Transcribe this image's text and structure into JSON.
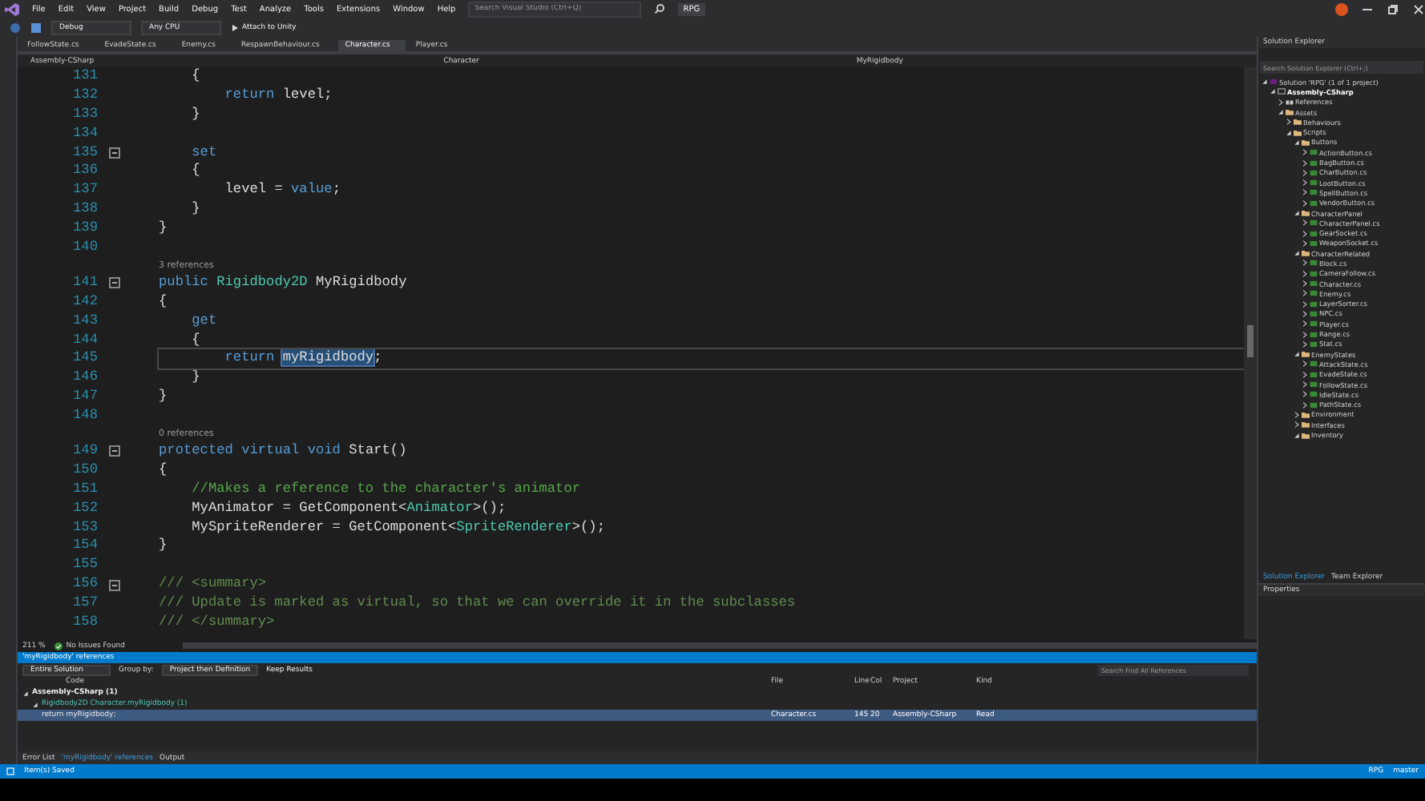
{
  "menu": [
    "File",
    "Edit",
    "View",
    "Project",
    "Build",
    "Debug",
    "Test",
    "Analyze",
    "Tools",
    "Extensions",
    "Window",
    "Help"
  ],
  "search": {
    "placeholder": "Search Visual Studio (Ctrl+Q)"
  },
  "project_name": "RPG",
  "toolbar": {
    "configuration": "Debug",
    "platform": "Any CPU",
    "run": "Attach to Unity"
  },
  "tabs": [
    {
      "label": "FollowState.cs",
      "selected": false
    },
    {
      "label": "EvadeState.cs",
      "selected": false
    },
    {
      "label": "Enemy.cs",
      "selected": false
    },
    {
      "label": "RespawnBehaviour.cs",
      "selected": false
    },
    {
      "label": "Character.cs",
      "selected": true
    },
    {
      "label": "Player.cs",
      "selected": false
    }
  ],
  "nav": [
    "Assembly-CSharp",
    "Character",
    "MyRigidbody"
  ],
  "code": [
    {
      "kind": "code",
      "number": "131",
      "tokens": [
        {
          "kind": "plain",
          "text": "    {"
        }
      ]
    },
    {
      "kind": "code",
      "number": "132",
      "tokens": [
        {
          "kind": "keyword",
          "text": "        return"
        },
        {
          "kind": "plain",
          "text": " level;"
        }
      ]
    },
    {
      "kind": "code",
      "number": "133",
      "tokens": [
        {
          "kind": "plain",
          "text": "    }"
        }
      ]
    },
    {
      "kind": "code",
      "number": "134"
    },
    {
      "kind": "code",
      "number": "135",
      "fold": true,
      "tokens": [
        {
          "kind": "keyword",
          "text": "    set"
        }
      ]
    },
    {
      "kind": "code",
      "number": "136",
      "tokens": [
        {
          "kind": "plain",
          "text": "    {"
        }
      ]
    },
    {
      "kind": "code",
      "number": "137",
      "tokens": [
        {
          "kind": "plain",
          "text": "        level = "
        },
        {
          "kind": "keyword",
          "text": "value"
        },
        {
          "kind": "plain",
          "text": ";"
        }
      ]
    },
    {
      "kind": "code",
      "number": "138",
      "tokens": [
        {
          "kind": "plain",
          "text": "    }"
        }
      ]
    },
    {
      "kind": "code",
      "number": "139",
      "tokens": [
        {
          "kind": "plain",
          "text": "}"
        }
      ]
    },
    {
      "kind": "code",
      "number": "140"
    },
    {
      "kind": "lens",
      "text": "3 references"
    },
    {
      "kind": "code",
      "number": "141",
      "fold": true,
      "tokens": [
        {
          "kind": "keyword",
          "text": "public "
        },
        {
          "kind": "type",
          "text": "Rigidbody2D"
        },
        {
          "kind": "plain",
          "text": " MyRigidbody"
        }
      ]
    },
    {
      "kind": "code",
      "number": "142",
      "tokens": [
        {
          "kind": "plain",
          "text": "{"
        }
      ]
    },
    {
      "kind": "code",
      "number": "143",
      "tokens": [
        {
          "kind": "keyword",
          "text": "    get"
        }
      ]
    },
    {
      "kind": "code",
      "number": "144",
      "tokens": [
        {
          "kind": "plain",
          "text": "    {"
        }
      ]
    },
    {
      "kind": "code",
      "number": "145",
      "current": true,
      "tokens": [
        {
          "kind": "keyword",
          "text": "        return "
        },
        {
          "kind": "highlight",
          "text": "myRigidbody"
        },
        {
          "kind": "plain",
          "text": ";"
        }
      ]
    },
    {
      "kind": "code",
      "number": "146",
      "tokens": [
        {
          "kind": "plain",
          "text": "    }"
        }
      ]
    },
    {
      "kind": "code",
      "number": "147",
      "tokens": [
        {
          "kind": "plain",
          "text": "}"
        }
      ]
    },
    {
      "kind": "code",
      "number": "148"
    },
    {
      "kind": "lens",
      "text": "0 references"
    },
    {
      "kind": "code",
      "number": "149",
      "fold": true,
      "tokens": [
        {
          "kind": "keyword",
          "text": "protected virtual void"
        },
        {
          "kind": "plain",
          "text": " Start()"
        }
      ]
    },
    {
      "kind": "code",
      "number": "150",
      "tokens": [
        {
          "kind": "plain",
          "text": "{"
        }
      ]
    },
    {
      "kind": "code",
      "number": "151",
      "tokens": [
        {
          "kind": "comment",
          "text": "    //Makes a reference to the character's animator"
        }
      ]
    },
    {
      "kind": "code",
      "number": "152",
      "tokens": [
        {
          "kind": "plain",
          "text": "    MyAnimator = GetComponent<"
        },
        {
          "kind": "type",
          "text": "Animator"
        },
        {
          "kind": "plain",
          "text": ">();"
        }
      ]
    },
    {
      "kind": "code",
      "number": "153",
      "tokens": [
        {
          "kind": "plain",
          "text": "    MySpriteRenderer = GetComponent<"
        },
        {
          "kind": "type",
          "text": "SpriteRenderer"
        },
        {
          "kind": "plain",
          "text": ">();"
        }
      ]
    },
    {
      "kind": "code",
      "number": "154",
      "tokens": [
        {
          "kind": "plain",
          "text": "}"
        }
      ]
    },
    {
      "kind": "code",
      "number": "155"
    },
    {
      "kind": "code",
      "number": "156",
      "fold": true,
      "tokens": [
        {
          "kind": "doc",
          "text": "/// <summary>"
        }
      ]
    },
    {
      "kind": "code",
      "number": "157",
      "tokens": [
        {
          "kind": "doc",
          "text": "/// Update is marked as virtual, so that we can override it in the subclasses"
        }
      ]
    },
    {
      "kind": "code",
      "number": "158",
      "tokens": [
        {
          "kind": "doc",
          "text": "/// </summary>"
        }
      ]
    }
  ],
  "editor_footer": {
    "zoom": "211 %",
    "issues": "No Issues Found"
  },
  "references_panel": {
    "title": "'myRigidbody' references",
    "scope": "Entire Solution",
    "group_by_label": "Group by:",
    "group_by": "Project then Definition",
    "keep_results": "Keep Results",
    "search_placeholder": "Search Find All References",
    "columns": [
      "Code",
      "File",
      "Line",
      "Col",
      "Project",
      "Kind"
    ],
    "rows": [
      {
        "kind": "project",
        "code": "Assembly-CSharp (1)",
        "expanded": true,
        "children": [
          {
            "kind": "definition",
            "code": "Rigidbody2D Character.myRigidbody (1)",
            "expanded": true,
            "children": [
              {
                "kind": "reference",
                "code": "return myRigidbody;",
                "file": "Character.cs",
                "line": "145",
                "col": "20",
                "project": "Assembly-CSharp",
                "ref_kind": "Read",
                "selected": true
              }
            ]
          }
        ]
      }
    ]
  },
  "bottom_tabs": [
    {
      "label": "Error List",
      "selected": false
    },
    {
      "label": "'myRigidbody' references",
      "selected": true
    },
    {
      "label": "Output",
      "selected": false
    }
  ],
  "solution_explorer": {
    "title": "Solution Explorer",
    "search_placeholder": "Search Solution Explorer (Ctrl+;)",
    "tree": [
      {
        "label": "Solution 'RPG' (1 of 1 project)",
        "kind": "solution",
        "expanded": true,
        "children": [
          {
            "label": "Assembly-CSharp",
            "kind": "project",
            "expanded": true,
            "children": [
              {
                "label": "References",
                "kind": "references",
                "expanded": false
              },
              {
                "label": "Assets",
                "kind": "folder",
                "expanded": true,
                "children": [
                  {
                    "label": "Behaviours",
                    "kind": "folder",
                    "expanded": false
                  },
                  {
                    "label": "Scripts",
                    "kind": "folder",
                    "expanded": true,
                    "children": [
                      {
                        "label": "Buttons",
                        "kind": "folder",
                        "expanded": true,
                        "children": [
                          {
                            "label": "ActionButton.cs",
                            "kind": "cs",
                            "expanded": false
                          },
                          {
                            "label": "BagButton.cs",
                            "kind": "cs",
                            "expanded": false
                          },
                          {
                            "label": "CharButton.cs",
                            "kind": "cs",
                            "expanded": false
                          },
                          {
                            "label": "LootButton.cs",
                            "kind": "cs",
                            "expanded": false
                          },
                          {
                            "label": "SpellButton.cs",
                            "kind": "cs",
                            "expanded": false
                          },
                          {
                            "label": "VendorButton.cs",
                            "kind": "cs",
                            "expanded": false
                          }
                        ]
                      },
                      {
                        "label": "CharacterPanel",
                        "kind": "folder",
                        "expanded": true,
                        "children": [
                          {
                            "label": "CharacterPanel.cs",
                            "kind": "cs",
                            "expanded": false
                          },
                          {
                            "label": "GearSocket.cs",
                            "kind": "cs",
                            "expanded": false
                          },
                          {
                            "label": "WeaponSocket.cs",
                            "kind": "cs",
                            "expanded": false
                          }
                        ]
                      },
                      {
                        "label": "CharacterRelated",
                        "kind": "folder",
                        "expanded": true,
                        "children": [
                          {
                            "label": "Block.cs",
                            "kind": "cs",
                            "expanded": false
                          },
                          {
                            "label": "CameraFollow.cs",
                            "kind": "cs",
                            "expanded": false
                          },
                          {
                            "label": "Character.cs",
                            "kind": "cs",
                            "expanded": false
                          },
                          {
                            "label": "Enemy.cs",
                            "kind": "cs",
                            "expanded": false
                          },
                          {
                            "label": "LayerSorter.cs",
                            "kind": "cs",
                            "expanded": false
                          },
                          {
                            "label": "NPC.cs",
                            "kind": "cs",
                            "expanded": false
                          },
                          {
                            "label": "Player.cs",
                            "kind": "cs",
                            "expanded": false
                          },
                          {
                            "label": "Range.cs",
                            "kind": "cs",
                            "expanded": false
                          },
                          {
                            "label": "Stat.cs",
                            "kind": "cs",
                            "expanded": false
                          }
                        ]
                      },
                      {
                        "label": "EnemyStates",
                        "kind": "folder",
                        "expanded": true,
                        "children": [
                          {
                            "label": "AttackState.cs",
                            "kind": "cs",
                            "expanded": false
                          },
                          {
                            "label": "EvadeState.cs",
                            "kind": "cs",
                            "expanded": false
                          },
                          {
                            "label": "FollowState.cs",
                            "kind": "cs",
                            "expanded": false
                          },
                          {
                            "label": "IdleState.cs",
                            "kind": "cs",
                            "expanded": false
                          },
                          {
                            "label": "PathState.cs",
                            "kind": "cs",
                            "expanded": false
                          }
                        ]
                      },
                      {
                        "label": "Environment",
                        "kind": "folder",
                        "expanded": false
                      },
                      {
                        "label": "Interfaces",
                        "kind": "folder",
                        "expanded": false
                      },
                      {
                        "label": "Inventory",
                        "kind": "folder",
                        "expanded": true
                      }
                    ]
                  }
                ]
              }
            ]
          }
        ]
      }
    ],
    "tabs": [
      {
        "label": "Solution Explorer",
        "selected": true
      },
      {
        "label": "Team Explorer",
        "selected": false
      }
    ]
  },
  "properties": {
    "title": "Properties"
  },
  "status_bar": {
    "message": "Item(s) Saved",
    "project": "RPG",
    "branch": "master"
  }
}
